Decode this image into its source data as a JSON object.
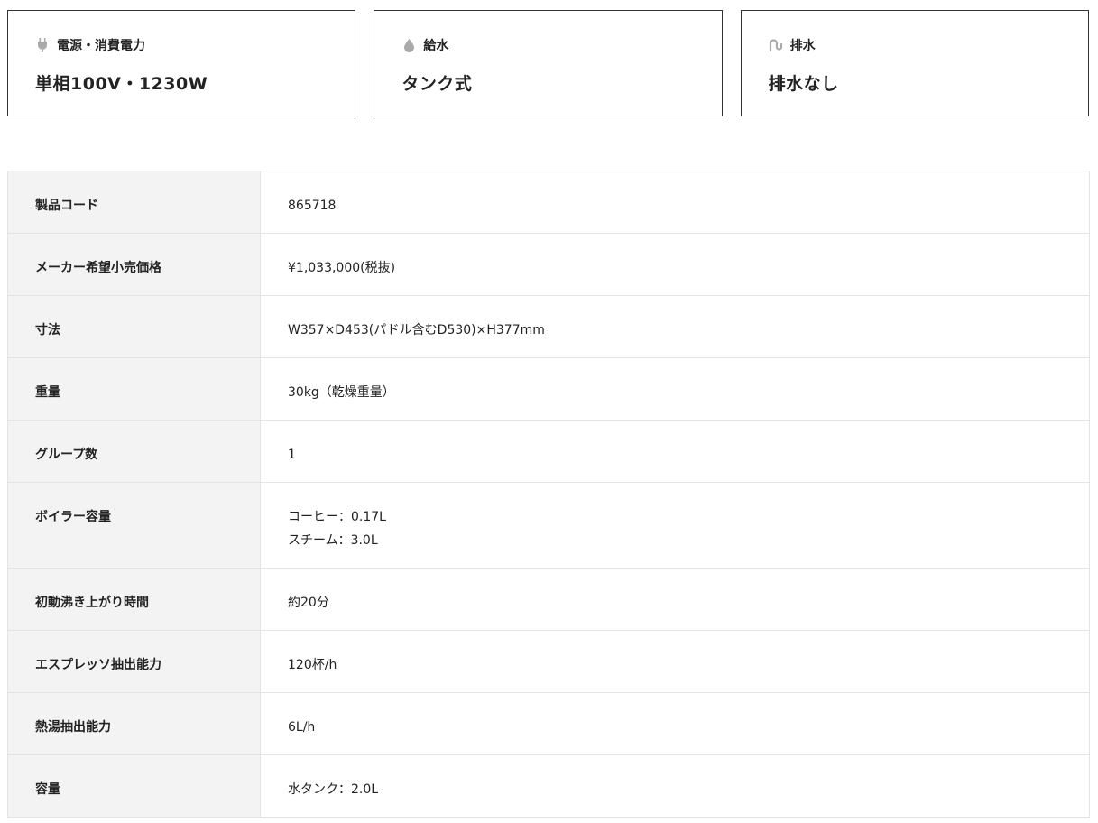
{
  "cards": [
    {
      "icon": "plug-icon",
      "label": "電源・消費電力",
      "value": "単相100V・1230W"
    },
    {
      "icon": "water-drop-icon",
      "label": "給水",
      "value": "タンク式"
    },
    {
      "icon": "drain-pipe-icon",
      "label": "排水",
      "value": "排水なし"
    }
  ],
  "specs": [
    {
      "label": "製品コード",
      "value": "865718"
    },
    {
      "label": "メーカー希望小売価格",
      "value": "¥1,033,000(税抜)"
    },
    {
      "label": "寸法",
      "value": "W357×D453(パドル含むD530)×H377mm"
    },
    {
      "label": "重量",
      "value": "30kg（乾燥重量）"
    },
    {
      "label": "グループ数",
      "value": "1"
    },
    {
      "label": "ボイラー容量",
      "value_line1": "コーヒー：0.17L",
      "value_line2": "スチーム：3.0L"
    },
    {
      "label": "初動沸き上がり時間",
      "value": "約20分"
    },
    {
      "label": "エスプレッソ抽出能力",
      "value": "120杯/h"
    },
    {
      "label": "熱湯抽出能力",
      "value": "6L/h"
    },
    {
      "label": "容量",
      "value": "水タンク：2.0L"
    }
  ],
  "colors": {
    "icon_gray": "#aaaaaa",
    "border_dark": "#333333",
    "header_bg": "#f3f3f3",
    "table_border": "#e4e4e4"
  }
}
